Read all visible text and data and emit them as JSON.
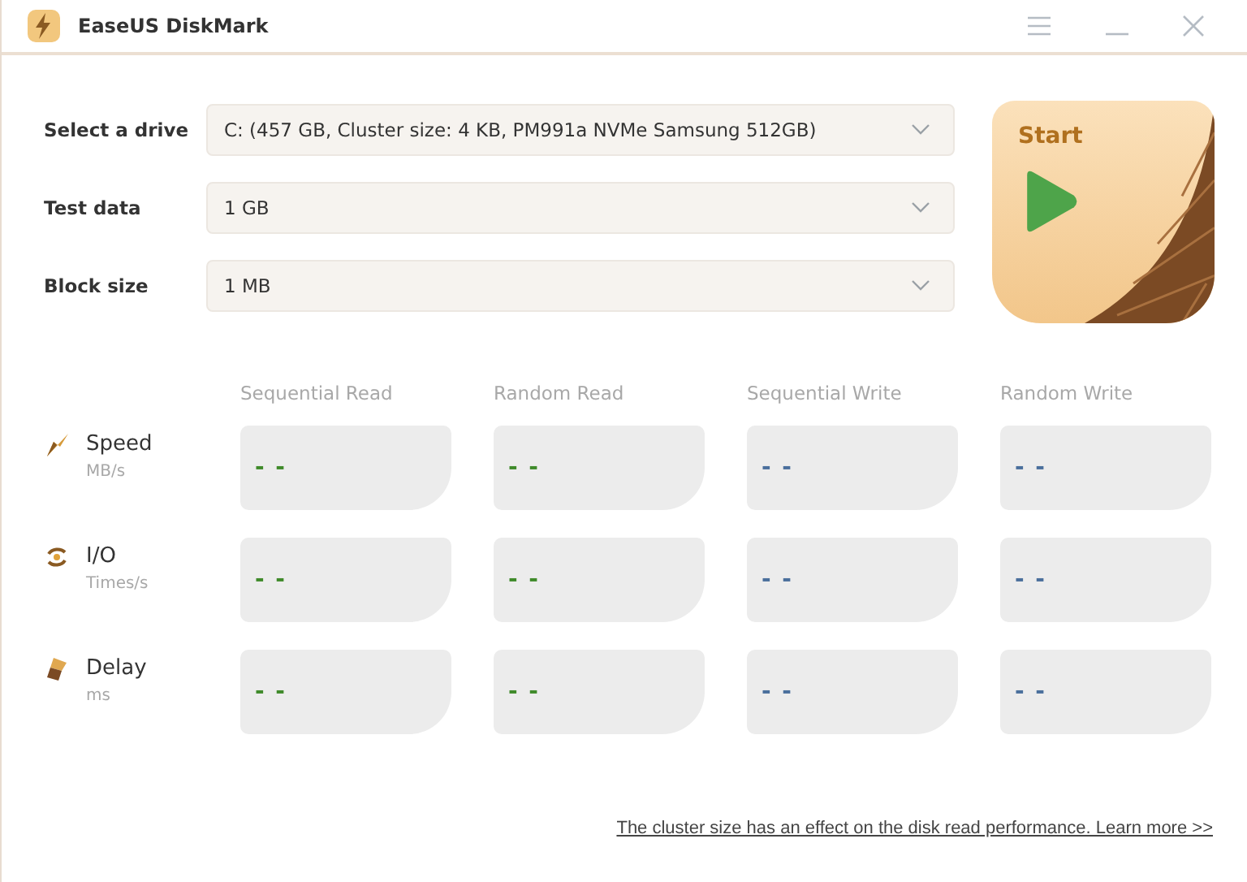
{
  "window": {
    "title": "EaseUS DiskMark"
  },
  "settings": [
    {
      "label": "Select a drive",
      "value": "C: (457 GB, Cluster size: 4 KB, PM991a NVMe Samsung 512GB)"
    },
    {
      "label": "Test data",
      "value": "1 GB"
    },
    {
      "label": "Block size",
      "value": "1 MB"
    }
  ],
  "start_button": {
    "label": "Start"
  },
  "columns": [
    {
      "label": "Sequential Read",
      "color": "#3f8a2a"
    },
    {
      "label": "Random Read",
      "color": "#3f8a2a"
    },
    {
      "label": "Sequential Write",
      "color": "#4a6f9c"
    },
    {
      "label": "Random Write",
      "color": "#4a6f9c"
    }
  ],
  "metrics": [
    {
      "kind": "speed",
      "name": "Speed",
      "unit": "MB/s",
      "values": [
        "- -",
        "- -",
        "- -",
        "- -"
      ]
    },
    {
      "kind": "io",
      "name": "I/O",
      "unit": "Times/s",
      "values": [
        "- -",
        "- -",
        "- -",
        "- -"
      ]
    },
    {
      "kind": "delay",
      "name": "Delay",
      "unit": "ms",
      "values": [
        "- -",
        "- -",
        "- -",
        "- -"
      ]
    }
  ],
  "footer_link": "The cluster size has an effect on the disk read performance. Learn more >>"
}
